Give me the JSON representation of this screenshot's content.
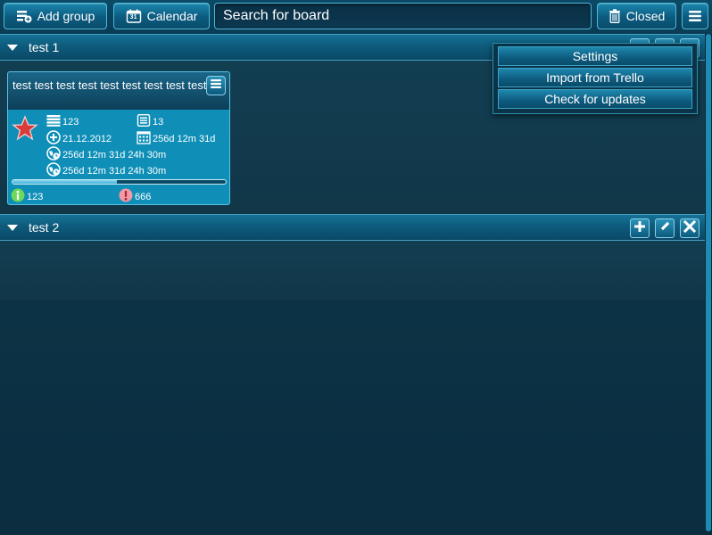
{
  "toolbar": {
    "add_group_label": "Add group",
    "calendar_label": "Calendar",
    "calendar_day": "31",
    "search_placeholder": "Search for board",
    "closed_label": "Closed"
  },
  "groups": [
    {
      "title": "test 1",
      "boards": [
        {
          "title": "test test test test test test test test test",
          "count_a": "123",
          "count_b": "13",
          "created": "21.12.2012",
          "duration": "256d 12m 31d",
          "time_1": "256d 12m 31d 24h 30m",
          "time_2": "256d 12m 31d 24h 30m",
          "progress": 0.49,
          "info_count": "123",
          "alert_count": "666"
        }
      ]
    },
    {
      "title": "test 2",
      "boards": []
    }
  ],
  "menu": {
    "items": [
      "Settings",
      "Import from Trello",
      "Check for updates"
    ]
  },
  "colors": {
    "accent": "#0f8fb8",
    "background": "#0c3447",
    "star": "#d93a3a",
    "info": "#6ed85a",
    "alert": "#f19aa6"
  }
}
